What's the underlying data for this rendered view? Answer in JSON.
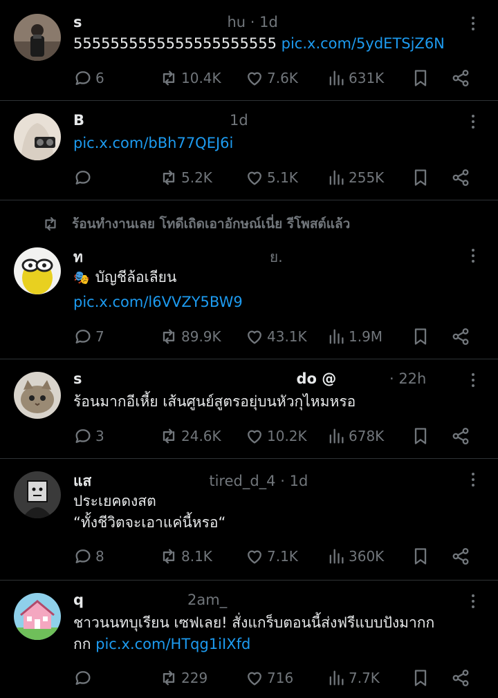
{
  "banner": {
    "text": "ร้อนทำงานเลย โทดีเถิดเอาอักษณ์เนี่ย รีโพสต์แล้ว"
  },
  "tweets": [
    {
      "name": "s",
      "handle_tail": "hu",
      "time": "1d",
      "text": "5555555555555555555555",
      "link": "pic.x.com/5ydETSjZ6N",
      "replies": "6",
      "reposts": "10.4K",
      "likes": "7.6K",
      "views": "631K"
    },
    {
      "name": "B",
      "handle_tail": "",
      "time": "1d",
      "text": "",
      "link": "pic.x.com/bBh77QEJ6i",
      "replies": "",
      "reposts": "5.2K",
      "likes": "5.1K",
      "views": "255K"
    },
    {
      "name": "ท",
      "handle_tail": "ย.",
      "time": "",
      "label": "บัญชีล้อเลียน",
      "text": "",
      "link": "pic.x.com/l6VVZY5BW9",
      "replies": "7",
      "reposts": "89.9K",
      "likes": "43.1K",
      "views": "1.9M"
    },
    {
      "name": "s",
      "handle_tail": "do @",
      "time": "22h",
      "text": "ร้อนมากอีเหี้ย เส้นศูนย์สูตรอยุ่บนหัวกุไหมหรอ",
      "link": "",
      "replies": "3",
      "reposts": "24.6K",
      "likes": "10.2K",
      "views": "678K"
    },
    {
      "name": "แส",
      "handle_tail": "tired_d_4",
      "time": "1d",
      "text": "ประเยคดงสต",
      "text2": "“ทั้งชีวิตจะเอาแค่นี้หรอ“",
      "link": "",
      "replies": "8",
      "reposts": "8.1K",
      "likes": "7.1K",
      "views": "360K"
    },
    {
      "name": "q",
      "handle_tail": "2am_",
      "time": "",
      "text": "ชาวนนทบุเรียน เซฟเลย! สั่งแกร็บตอนนี้ส่งฟรีแบบปังมากก",
      "text2": "กก",
      "link": "pic.x.com/HTqg1iIXfd",
      "replies": "",
      "reposts": "229",
      "likes": "716",
      "views": "7.7K"
    }
  ],
  "colors": {
    "background": "#000000",
    "text": "#e7e9ea",
    "muted": "#71767b",
    "link": "#1d9bf0",
    "divider": "#2f3336"
  }
}
